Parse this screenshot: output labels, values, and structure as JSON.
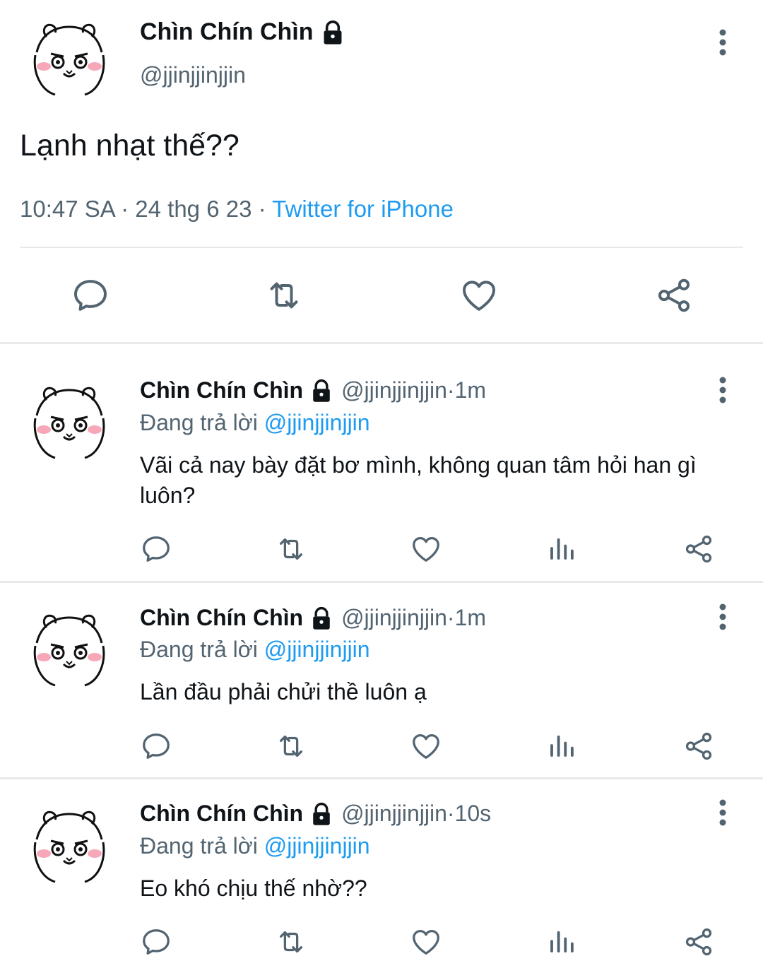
{
  "main_tweet": {
    "name": "Chìn Chín Chìn",
    "handle": "@jjinjjinjjin",
    "text": "Lạnh nhạt thế??",
    "time": "10:47 SA",
    "date": "24 thg 6 23",
    "source": "Twitter for iPhone",
    "actions": [
      "reply-icon",
      "retweet-icon",
      "like-icon",
      "share-icon"
    ]
  },
  "replies": [
    {
      "name": "Chìn Chín Chìn",
      "handle": "@jjinjjinjjin",
      "age": "1m",
      "replying_label": "Đang trả lời",
      "replying_to": "@jjinjjinjjin",
      "text": "Vãi cả nay bày đặt bơ mình, không quan tâm hỏi han gì luôn?"
    },
    {
      "name": "Chìn Chín Chìn",
      "handle": "@jjinjjinjjin",
      "age": "1m",
      "replying_label": "Đang trả lời",
      "replying_to": "@jjinjjinjjin",
      "text": "Lần đầu phải chửi thề luôn ạ"
    },
    {
      "name": "Chìn Chín Chìn",
      "handle": "@jjinjjinjjin",
      "age": "10s",
      "replying_label": "Đang trả lời",
      "replying_to": "@jjinjjinjjin",
      "text": "Eo khó chịu thế nhờ??"
    }
  ],
  "colors": {
    "link": "#1d9bf0",
    "secondary": "#536471",
    "text": "#0f1419"
  },
  "separator": " · "
}
